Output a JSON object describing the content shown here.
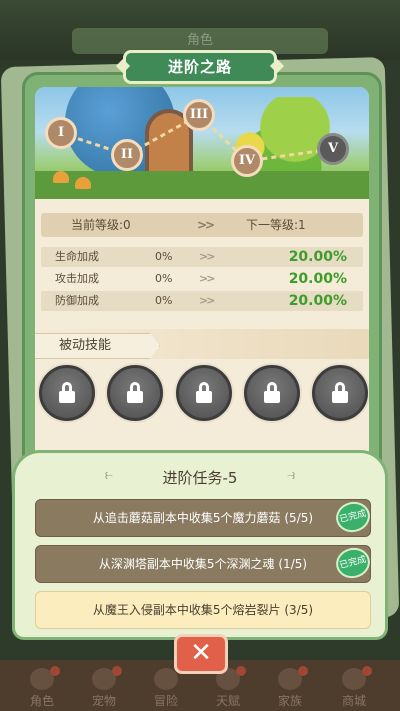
{
  "background": {
    "title": "角色"
  },
  "dialog": {
    "title": "进阶之路",
    "nodes": [
      "I",
      "II",
      "III",
      "IV",
      "V"
    ],
    "level": {
      "current_label": "当前等级:",
      "current_value": "0",
      "next_label": "下一等级:",
      "next_value": "1",
      "arrows": ">>"
    },
    "stats": [
      {
        "label": "生命加成",
        "current": "0%",
        "next": "20.00%"
      },
      {
        "label": "攻击加成",
        "current": "0%",
        "next": "20.00%"
      },
      {
        "label": "防御加成",
        "current": "0%",
        "next": "20.00%"
      }
    ],
    "passive_skills": {
      "label": "被动技能",
      "slots_locked": [
        true,
        true,
        true,
        true,
        true
      ]
    }
  },
  "tasks": {
    "title": "进阶任务-5",
    "items": [
      {
        "text": "从追击蘑菇副本中收集5个魔力蘑菇 (5/5)",
        "status": "done",
        "stamp": "已完成"
      },
      {
        "text": "从深渊塔副本中收集5个深渊之魂 (1/5)",
        "status": "done",
        "stamp": "已完成"
      },
      {
        "text": "从魔王入侵副本中收集5个熔岩裂片 (3/5)",
        "status": "todo"
      }
    ]
  },
  "close_button": {
    "icon": "close-icon",
    "glyph": "✕"
  },
  "bottom_nav": [
    {
      "label": "角色",
      "icon": "character-icon",
      "badge": true
    },
    {
      "label": "宠物",
      "icon": "pet-icon",
      "badge": true
    },
    {
      "label": "冒险",
      "icon": "adventure-icon",
      "badge": false
    },
    {
      "label": "天赋",
      "icon": "talent-icon",
      "badge": true
    },
    {
      "label": "家族",
      "icon": "guild-icon",
      "badge": true
    },
    {
      "label": "商城",
      "icon": "shop-icon",
      "badge": true
    }
  ],
  "colors": {
    "accent_green": "#3f8a57",
    "value_green": "#3f9c2a",
    "close_red": "#e0604a"
  }
}
